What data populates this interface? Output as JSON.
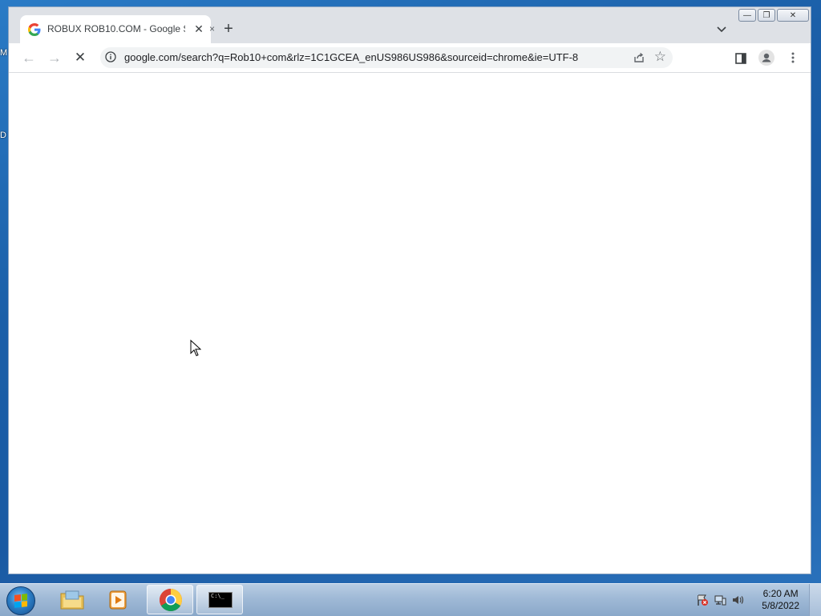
{
  "desktop": {
    "icon_labels": [
      "M",
      "D"
    ]
  },
  "browser": {
    "tab": {
      "title": "ROBUX ROB10.COM - Google Se",
      "close_glyph": "✕",
      "fade_glyph": "×"
    },
    "new_tab_glyph": "+",
    "tab_search_icon": "chevron-down-icon",
    "window_controls": {
      "minimize": "—",
      "restore": "❐",
      "close": "✕"
    },
    "nav": {
      "back": "←",
      "forward": "→",
      "stop": "✕"
    },
    "address_bar": {
      "url": "google.com/search?q=Rob10+com&rlz=1C1GCEA_enUS986US986&sourceid=chrome&ie=UTF-8"
    },
    "toolbar_icons": [
      "share-icon",
      "star-icon",
      "side-panel-icon",
      "profile-icon",
      "menu-icon"
    ]
  },
  "taskbar": {
    "items": [
      "start-button",
      "explorer-icon",
      "media-player-icon",
      "chrome-icon",
      "cmd-icon"
    ],
    "active_item": "chrome-icon",
    "cmd_label": "C:\\_",
    "clock": {
      "time": "6:20 AM",
      "date": "5/8/2022"
    }
  },
  "colors": {
    "accent": "#1a73e8",
    "taskbar": "#9fb9d6",
    "desktop": "#1b5fa8"
  }
}
